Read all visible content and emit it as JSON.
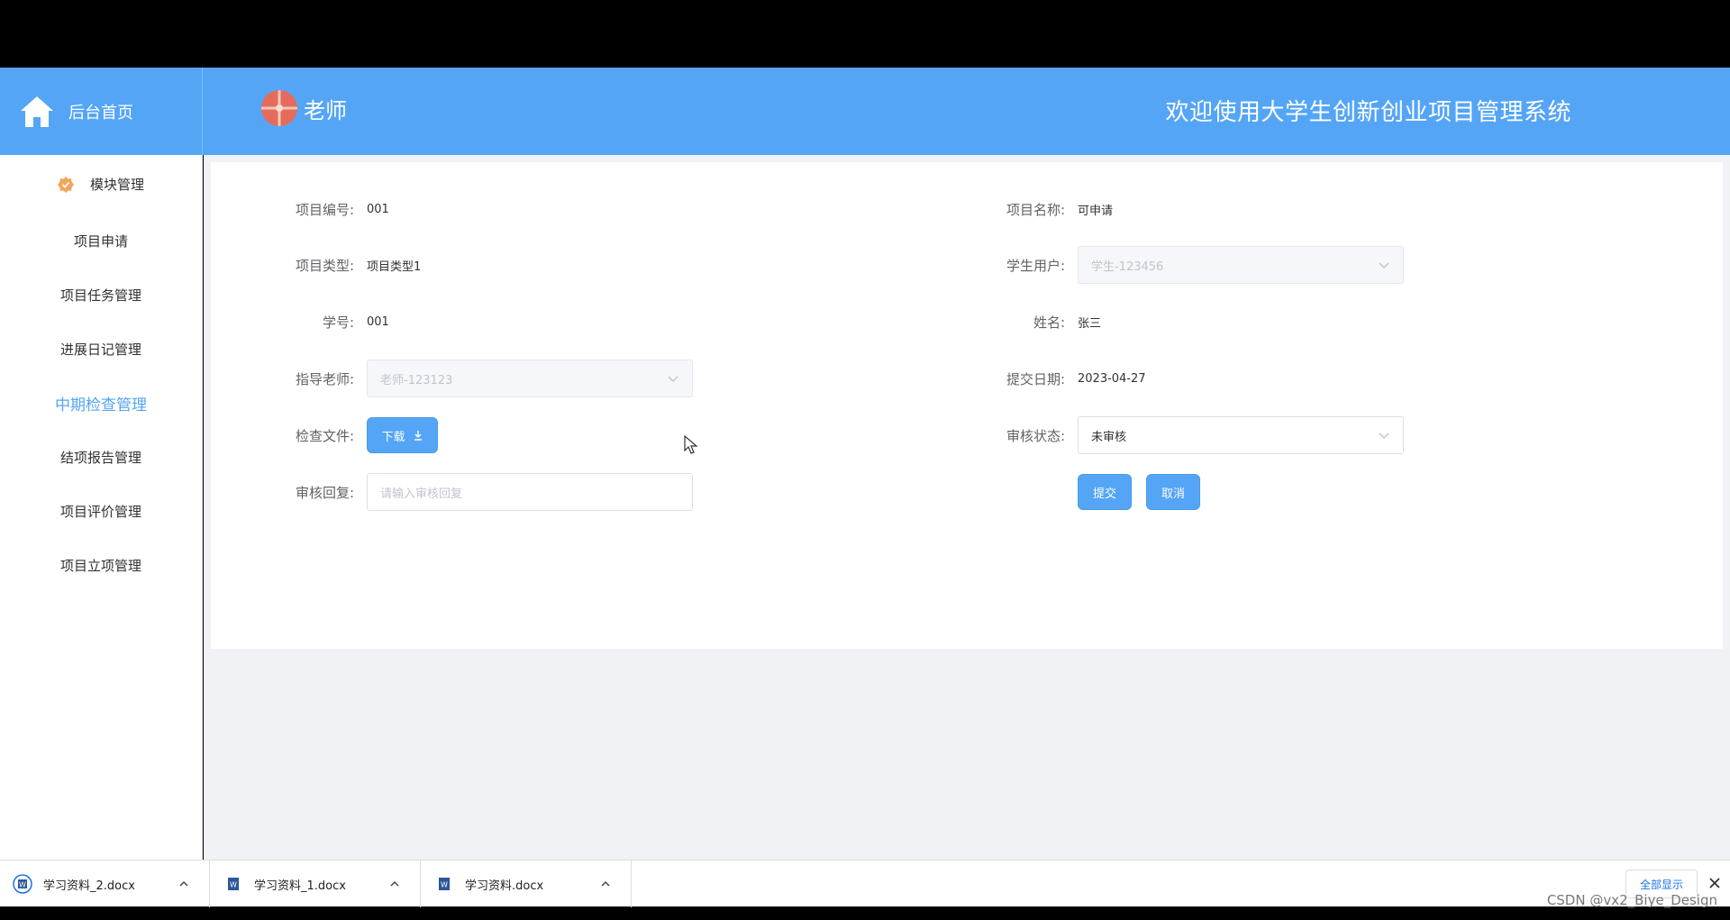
{
  "header": {
    "home_label": "后台首页",
    "role": "老师",
    "system_title": "欢迎使用大学生创新创业项目管理系统"
  },
  "sidebar": {
    "section": "模块管理",
    "items": [
      "项目申请",
      "项目任务管理",
      "进展日记管理",
      "中期检查管理",
      "结项报告管理",
      "项目评价管理",
      "项目立项管理"
    ],
    "active_index": 3
  },
  "form": {
    "project_no": {
      "label": "项目编号:",
      "value": "001"
    },
    "project_name": {
      "label": "项目名称:",
      "value": "可申请"
    },
    "project_type": {
      "label": "项目类型:",
      "value": "项目类型1"
    },
    "student_user": {
      "label": "学生用户:",
      "value": "学生-123456"
    },
    "student_id": {
      "label": "学号:",
      "value": "001"
    },
    "name": {
      "label": "姓名:",
      "value": "张三"
    },
    "teacher": {
      "label": "指导老师:",
      "value": "老师-123123"
    },
    "submit_date": {
      "label": "提交日期:",
      "value": "2023-04-27"
    },
    "check_file": {
      "label": "检查文件:",
      "button": "下载"
    },
    "review_status": {
      "label": "审核状态:",
      "value": "未审核"
    },
    "review_reply": {
      "label": "审核回复:",
      "placeholder": "请输入审核回复"
    },
    "submit_label": "提交",
    "cancel_label": "取消"
  },
  "downloads": {
    "files": [
      "学习资料_2.docx",
      "学习资料_1.docx",
      "学习资料.docx"
    ],
    "show_all": "全部显示"
  },
  "watermark": "CSDN @vx2_Biye_Design",
  "colors": {
    "primary": "#54a5f6",
    "active_menu": "#54a5f6",
    "avatar": "#e56b5c"
  }
}
